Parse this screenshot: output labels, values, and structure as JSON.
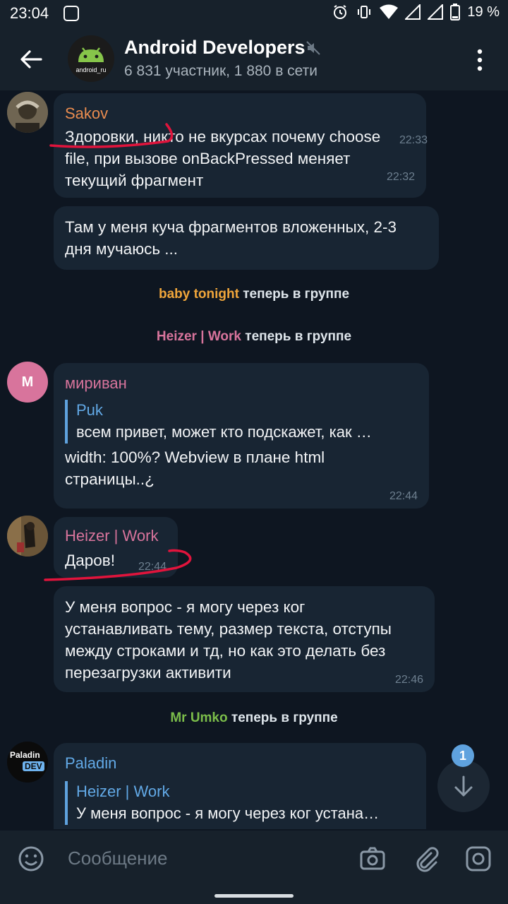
{
  "status_bar": {
    "time": "23:04",
    "battery": "19 %"
  },
  "header": {
    "title": "Android Developers",
    "subtitle": "6 831 участник, 1 880 в сети",
    "avatar_text": "android_ru"
  },
  "messages": [
    {
      "sender": "Sakov",
      "text_lines": [
        "Здоровки, никто не вкурсах почему choose",
        "file, при вызове onBackPressed меняет",
        "текущий фрагмент"
      ],
      "time": "22:32"
    },
    {
      "text_lines": [
        "Там у меня куча фрагментов вложенных, 2-3",
        "дня мучаюсь ..."
      ],
      "time": "22:33"
    },
    {
      "sender": "мириван",
      "avatar_letter": "М",
      "reply_name": "Puk",
      "reply_text": "всем привет, может кто подскажет, как …",
      "text_lines": [
        "width: 100%? Webview в плане html",
        "страницы..¿"
      ],
      "time": "22:44"
    },
    {
      "sender": "Heizer | Work",
      "text_lines": [
        "Даров!"
      ],
      "time": "22:44"
    },
    {
      "text_lines": [
        "У меня вопрос - я могу через ког",
        "устанавливать тему, размер текста, отступы",
        "между строками и тд, но как это делать без",
        "перезагрузки активити"
      ],
      "time": "22:46"
    },
    {
      "sender": "Paladin",
      "avatar_text1": "Paladin",
      "avatar_text2": "DEV",
      "reply_name": "Heizer | Work",
      "reply_text": "У меня вопрос - я могу через ког устана…"
    }
  ],
  "service": [
    {
      "name": "baby tonight",
      "text": "теперь в группе"
    },
    {
      "name": "Heizer | Work",
      "text": "теперь в группе"
    },
    {
      "name": "Mr Umko",
      "text": "теперь в группе"
    }
  ],
  "scroll_badge": "1",
  "composer": {
    "placeholder": "Сообщение"
  },
  "colors": {
    "background": "#0e1621",
    "bubble": "#182533",
    "bar": "#17212b",
    "sakov": "#e98c4f",
    "pink": "#d8749c",
    "blue": "#62a9e6",
    "orange": "#f0a63b",
    "green": "#7bbd4a",
    "annotation": "#e0143c"
  }
}
